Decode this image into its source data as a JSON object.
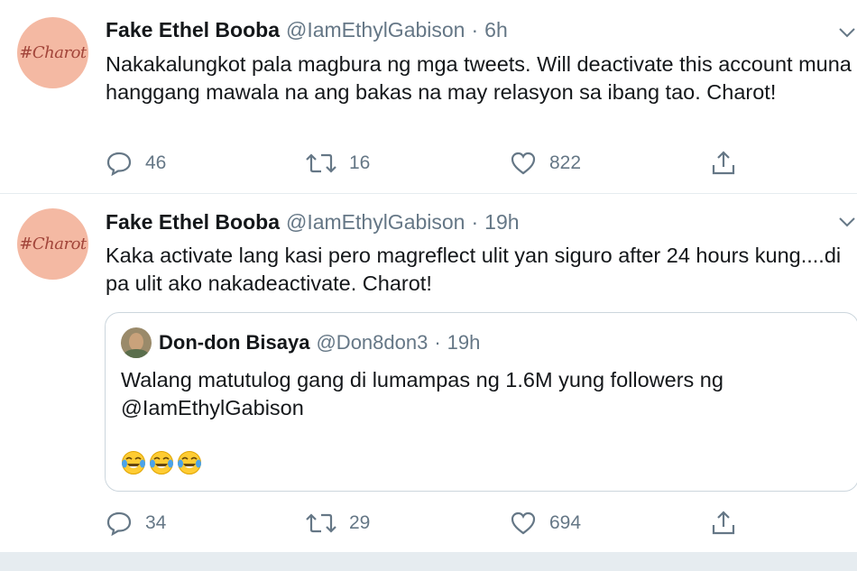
{
  "tweets": [
    {
      "author": "Fake Ethel Booba",
      "handle": "@IamEthylGabison",
      "separator": "·",
      "time": "6h",
      "avatar_text": "#Charot",
      "text": "Nakakalungkot pala magbura ng mga tweets. Will deactivate this account muna hanggang mawala na ang bakas na may relasyon sa ibang tao. Charot!",
      "replies": "46",
      "retweets": "16",
      "likes": "822"
    },
    {
      "author": "Fake Ethel Booba",
      "handle": "@IamEthylGabison",
      "separator": "·",
      "time": "19h",
      "avatar_text": "#Charot",
      "text": "Kaka activate lang kasi pero magreflect ulit yan siguro after 24 hours kung....di pa ulit ako nakadeactivate. Charot!",
      "replies": "34",
      "retweets": "29",
      "likes": "694",
      "quote": {
        "author": "Don-don Bisaya",
        "handle": "@Don8don3",
        "separator": "·",
        "time": "19h",
        "text": "Walang matutulog gang di lumampas ng 1.6M yung followers ng @IamEthylGabison",
        "emojis": [
          "face-with-tears-of-joy",
          "face-with-tears-of-joy",
          "face-with-tears-of-joy"
        ]
      }
    }
  ],
  "colors": {
    "text": "#14171a",
    "secondary": "#657786",
    "border": "#e6ecf0",
    "avatar_bg": "#f4b9a3",
    "avatar_text": "#a2453a"
  }
}
